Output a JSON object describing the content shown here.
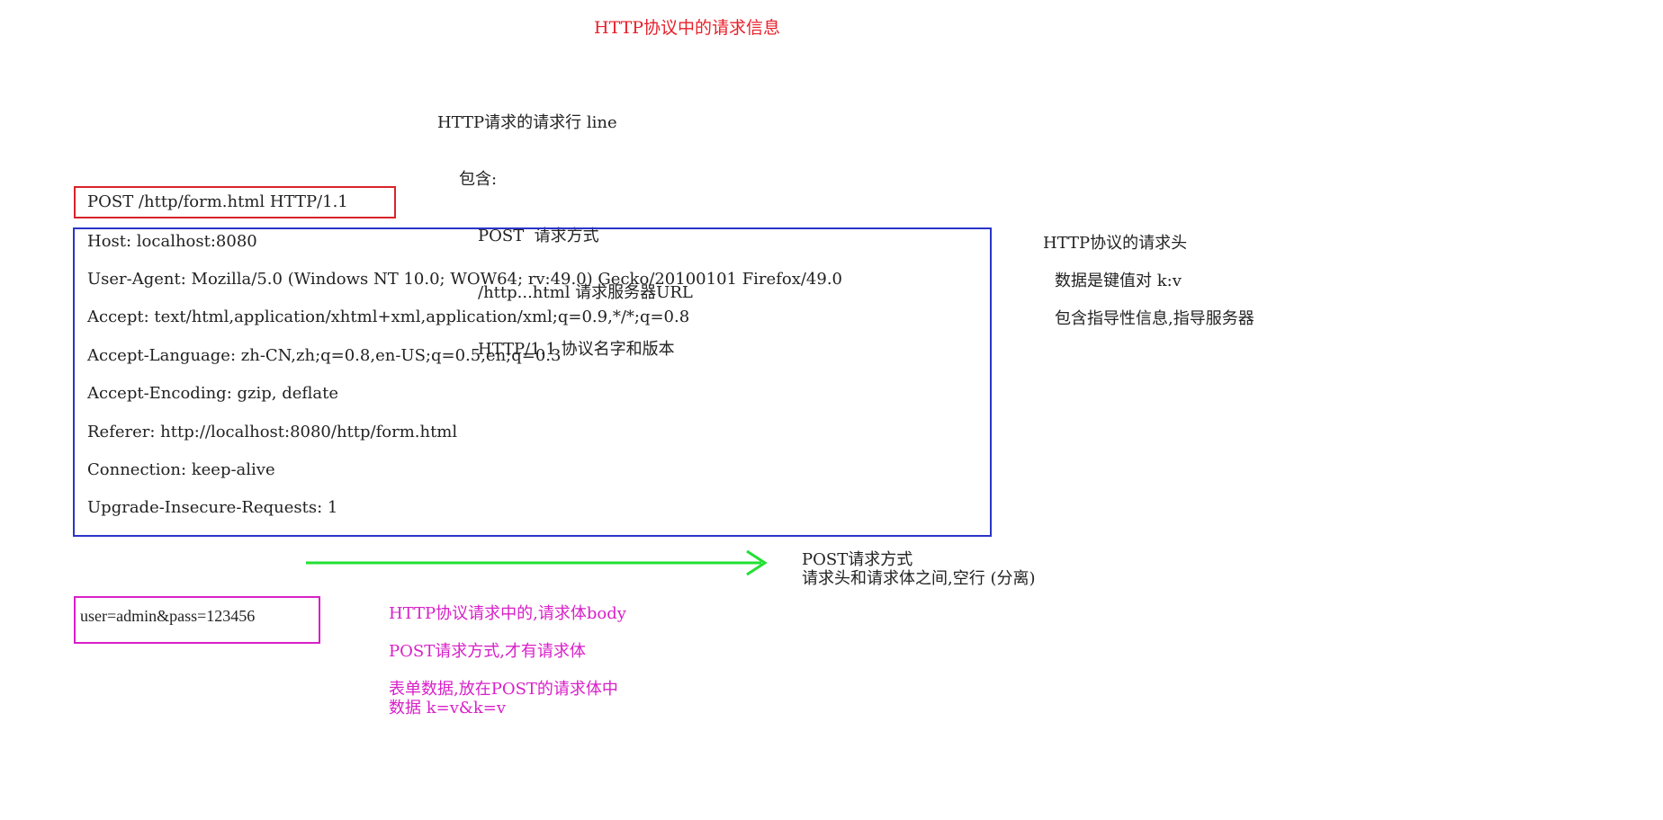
{
  "title": "HTTP协议中的请求信息",
  "request_line_note": {
    "heading": "HTTP请求的请求行 line",
    "contains": "包含:",
    "items": [
      "POST  请求方式",
      "/http...html 请求服务器URL",
      "HTTP/1.1 协议名字和版本"
    ]
  },
  "request_line": "POST /http/form.html HTTP/1.1",
  "headers": [
    "Host: localhost:8080",
    "User-Agent: Mozilla/5.0 (Windows NT 10.0; WOW64; rv:49.0) Gecko/20100101 Firefox/49.0",
    "Accept: text/html,application/xhtml+xml,application/xml;q=0.9,*/*;q=0.8",
    "Accept-Language: zh-CN,zh;q=0.8,en-US;q=0.5,en;q=0.3",
    "Accept-Encoding: gzip, deflate",
    "Referer: http://localhost:8080/http/form.html",
    "Connection: keep-alive",
    "Upgrade-Insecure-Requests: 1"
  ],
  "headers_note": {
    "heading": "HTTP协议的请求头",
    "kv": "数据是键值对 k:v",
    "guide": "包含指导性信息,指导服务器"
  },
  "arrow_note": {
    "line1": "POST请求方式",
    "line2": "请求头和请求体之间,空行 (分离)"
  },
  "body": "user=admin&pass=123456",
  "body_note": {
    "line1": "HTTP协议请求中的,请求体body",
    "line2": "POST请求方式,才有请求体",
    "line3": "表单数据,放在POST的请求体中",
    "line4": "数据 k=v&k=v"
  },
  "colors": {
    "title": "#e8202a",
    "request_line_border": "#d8242a",
    "headers_border": "#2a35c8",
    "arrow": "#22e032",
    "body_border": "#d820c8",
    "body_note": "#d820c8"
  }
}
